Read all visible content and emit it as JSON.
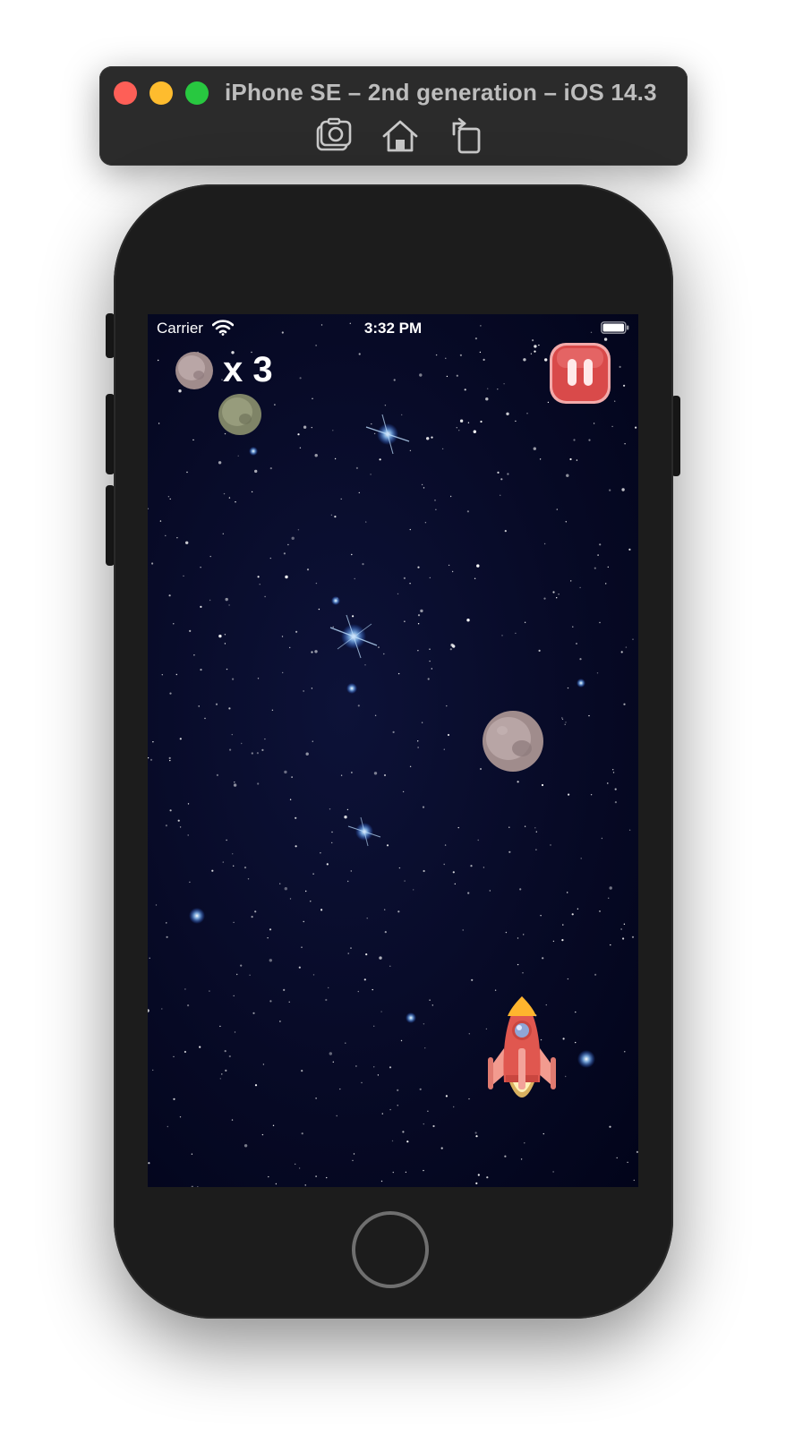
{
  "window": {
    "title": "iPhone SE – 2nd generation – iOS 14.3",
    "toolbar": {
      "screenshot_icon": "camera-icon",
      "home_icon": "home-icon",
      "rotate_icon": "rotate-icon"
    }
  },
  "status_bar": {
    "carrier": "Carrier",
    "time": "3:32 PM"
  },
  "hud": {
    "lives_label": "x 3",
    "pause_icon": "pause-icon"
  },
  "colors": {
    "space": "#050828",
    "pause_red": "#d94a4a",
    "rocket_red": "#e0574f",
    "flame": "#ffb52e"
  }
}
